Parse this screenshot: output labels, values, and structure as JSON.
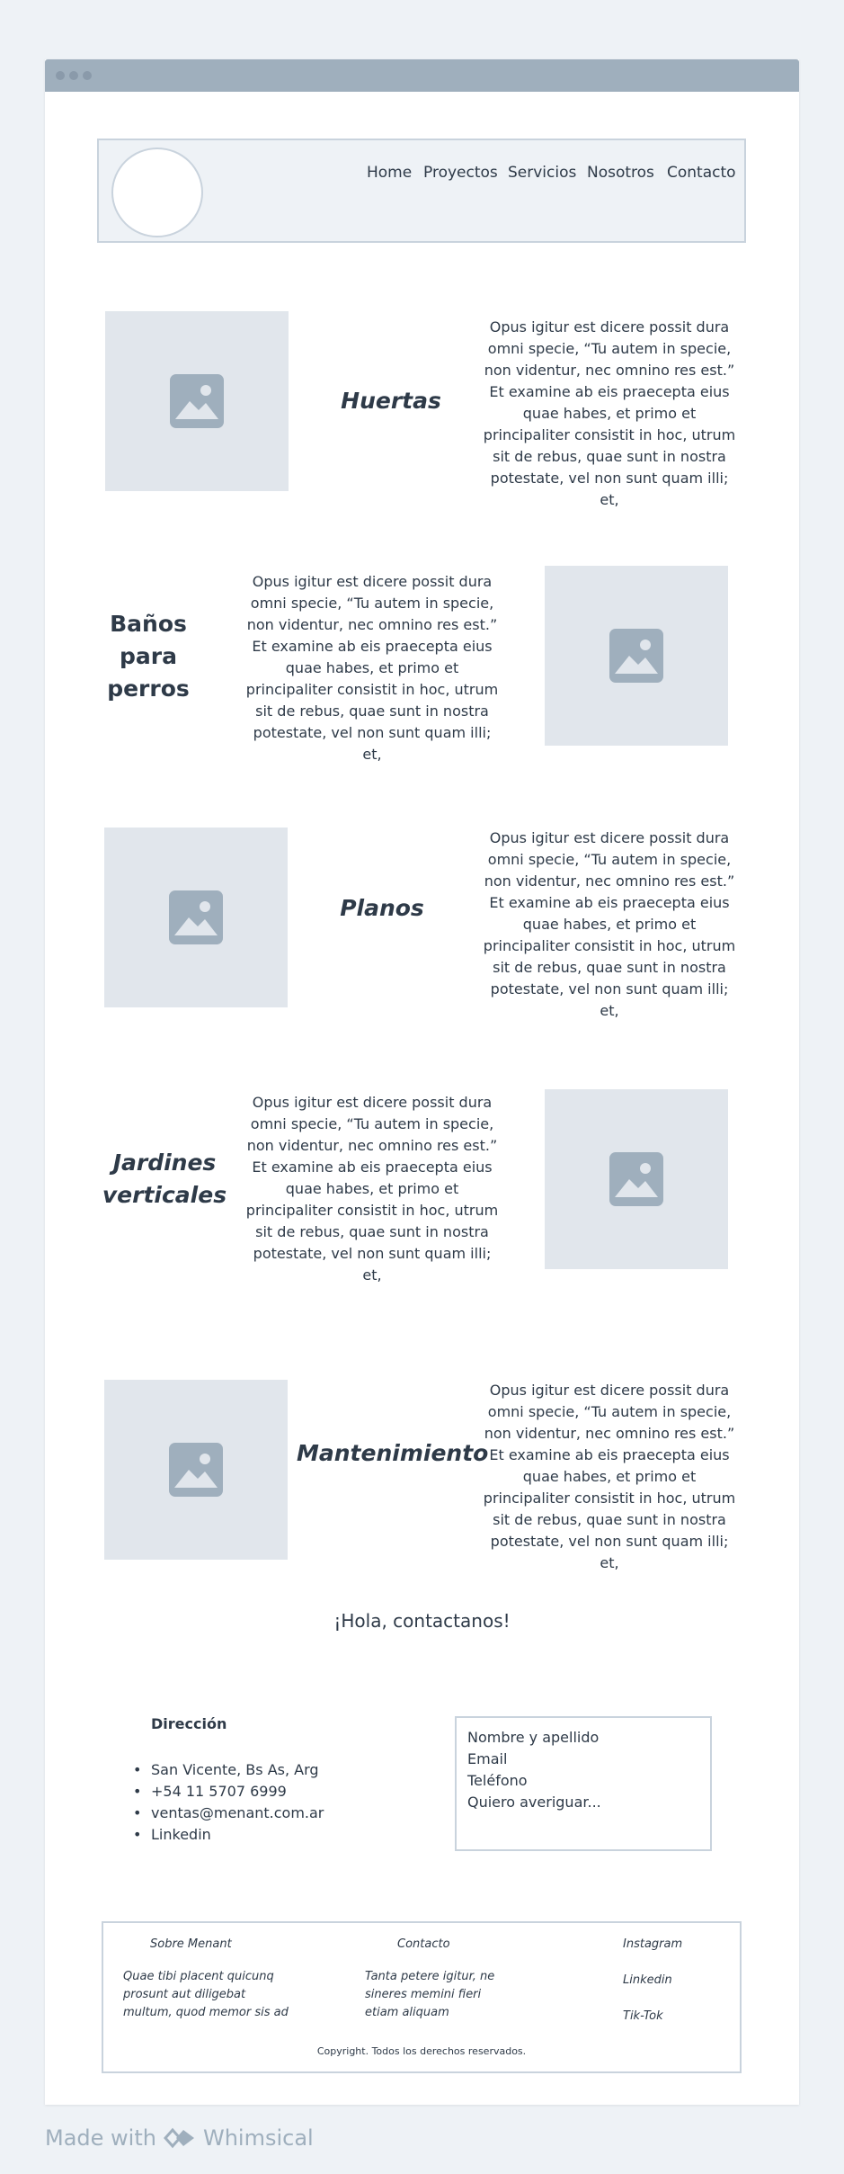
{
  "header": {
    "nav": [
      "Home",
      "Proyectos",
      "Servicios",
      "Nosotros",
      "Contacto"
    ]
  },
  "services": [
    {
      "title": "Huertas",
      "text": "Opus igitur est dicere possit dura omni specie, “Tu autem in specie, non videntur, nec omnino res est.” Et examine ab eis praecepta eius quae habes, et primo et principaliter consistit in hoc, utrum sit de rebus, quae sunt in nostra potestate, vel non sunt quam illi; et,"
    },
    {
      "title": "Baños para perros",
      "text": "Opus igitur est dicere possit dura omni specie, “Tu autem in specie, non videntur, nec omnino res est.” Et examine ab eis praecepta eius quae habes, et primo et principaliter consistit in hoc, utrum sit de rebus, quae sunt in nostra potestate, vel non sunt quam illi; et,"
    },
    {
      "title": "Planos",
      "text": "Opus igitur est dicere possit dura omni specie, “Tu autem in specie, non videntur, nec omnino res est.” Et examine ab eis praecepta eius quae habes, et primo et principaliter consistit in hoc, utrum sit de rebus, quae sunt in nostra potestate, vel non sunt quam illi; et,"
    },
    {
      "title": "Jardines verticales",
      "text": "Opus igitur est dicere possit dura omni specie, “Tu autem in specie, non videntur, nec omnino res est.” Et examine ab eis praecepta eius quae habes, et primo et principaliter consistit in hoc, utrum sit de rebus, quae sunt in nostra potestate, vel non sunt quam illi; et,"
    },
    {
      "title": "Mantenimiento",
      "text": "Opus igitur est dicere possit dura omni specie, “Tu autem in specie, non videntur, nec omnino res est.” Et examine ab eis praecepta eius quae habes, et primo et principaliter consistit in hoc, utrum sit de rebus, quae sunt in nostra potestate, vel non sunt quam illi; et,"
    }
  ],
  "contact": {
    "heading": "¡Hola, contactanos!",
    "address_title": "Dirección",
    "address_items": [
      "San Vicente, Bs As, Arg",
      "+54 11 5707 6999",
      "ventas@menant.com.ar",
      "Linkedin"
    ],
    "form_fields": [
      "Nombre y apellido",
      "Email",
      "Teléfono",
      "Quiero averiguar..."
    ]
  },
  "footer": {
    "col1_title": "Sobre Menant",
    "col1_text": "Quae tibi placent quicunq prosunt aut diligebat multum, quod memor sis ad",
    "col2_title": "Contacto",
    "col2_text": "Tanta petere igitur, ne sineres memini fieri etiam aliquam",
    "social": [
      "Instagram",
      "Linkedin",
      "Tik-Tok"
    ],
    "copyright": "Copyright. Todos los derechos reservados."
  },
  "branding": {
    "made_with": "Made with",
    "name": "Whimsical"
  },
  "colors": {
    "page_bg": "#eef2f6",
    "titlebar": "#9fafbd",
    "placeholder": "#e1e6ec",
    "placeholder_icon": "#9fafbd",
    "border": "#c9d3dd",
    "text": "#2e3a48"
  },
  "icons": {
    "image_placeholder": "image-icon",
    "logo": "circle-logo",
    "brand": "whimsical-logo-icon"
  }
}
